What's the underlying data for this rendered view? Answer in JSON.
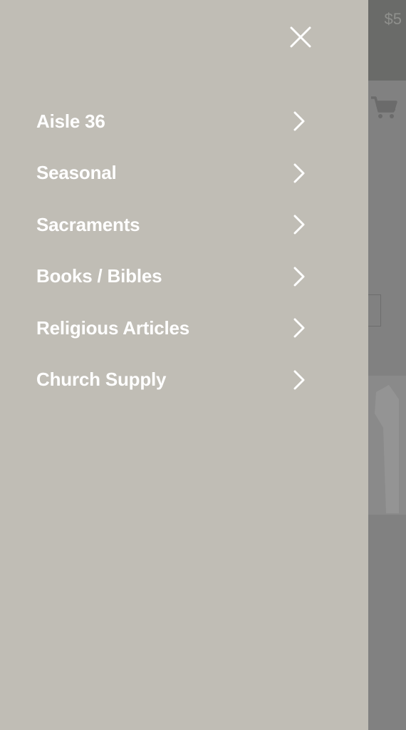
{
  "background": {
    "price_text": "$5",
    "cart_icon": "cart-icon"
  },
  "drawer": {
    "close_icon": "close-icon",
    "items": [
      {
        "label": "Aisle 36",
        "icon": "chevron-right-icon"
      },
      {
        "label": "Seasonal",
        "icon": "chevron-right-icon"
      },
      {
        "label": "Sacraments",
        "icon": "chevron-right-icon"
      },
      {
        "label": "Books / Bibles",
        "icon": "chevron-right-icon"
      },
      {
        "label": "Religious Articles",
        "icon": "chevron-right-icon"
      },
      {
        "label": "Church Supply",
        "icon": "chevron-right-icon"
      }
    ]
  },
  "colors": {
    "drawer_background": "#c0bdb5",
    "overlay": "#818181",
    "text": "#ffffff"
  }
}
